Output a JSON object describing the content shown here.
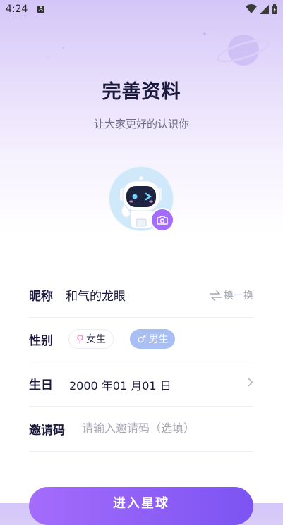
{
  "status_bar": {
    "time": "4:24",
    "badge": "A"
  },
  "header": {
    "title": "完善资料",
    "subtitle": "让大家更好的认识你"
  },
  "avatar": {
    "icons": [
      "robot-avatar",
      "camera-icon"
    ]
  },
  "form": {
    "nickname": {
      "label": "昵称",
      "value": "和气的龙眼",
      "swap_label": "换一换"
    },
    "gender": {
      "label": "性别",
      "female_label": "女生",
      "male_label": "男生",
      "selected": "男生"
    },
    "birthday": {
      "label": "生日",
      "value": "2000 年01 月01 日"
    },
    "invite": {
      "label": "邀请码",
      "placeholder": "请输入邀请码（选填）",
      "value": ""
    }
  },
  "submit": {
    "label": "进入星球"
  },
  "colors": {
    "accent": "#8f5ff7",
    "male_chip": "#a9bff3",
    "female_symbol": "#ef7fb5"
  }
}
